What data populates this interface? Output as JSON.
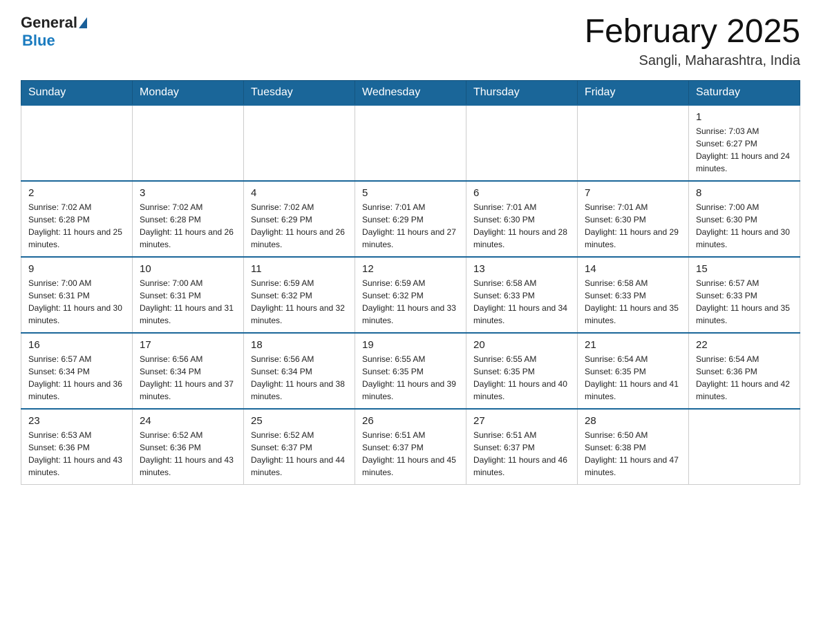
{
  "logo": {
    "general": "General",
    "blue": "Blue"
  },
  "title": "February 2025",
  "subtitle": "Sangli, Maharashtra, India",
  "days_of_week": [
    "Sunday",
    "Monday",
    "Tuesday",
    "Wednesday",
    "Thursday",
    "Friday",
    "Saturday"
  ],
  "weeks": [
    [
      {
        "day": "",
        "info": ""
      },
      {
        "day": "",
        "info": ""
      },
      {
        "day": "",
        "info": ""
      },
      {
        "day": "",
        "info": ""
      },
      {
        "day": "",
        "info": ""
      },
      {
        "day": "",
        "info": ""
      },
      {
        "day": "1",
        "info": "Sunrise: 7:03 AM\nSunset: 6:27 PM\nDaylight: 11 hours and 24 minutes."
      }
    ],
    [
      {
        "day": "2",
        "info": "Sunrise: 7:02 AM\nSunset: 6:28 PM\nDaylight: 11 hours and 25 minutes."
      },
      {
        "day": "3",
        "info": "Sunrise: 7:02 AM\nSunset: 6:28 PM\nDaylight: 11 hours and 26 minutes."
      },
      {
        "day": "4",
        "info": "Sunrise: 7:02 AM\nSunset: 6:29 PM\nDaylight: 11 hours and 26 minutes."
      },
      {
        "day": "5",
        "info": "Sunrise: 7:01 AM\nSunset: 6:29 PM\nDaylight: 11 hours and 27 minutes."
      },
      {
        "day": "6",
        "info": "Sunrise: 7:01 AM\nSunset: 6:30 PM\nDaylight: 11 hours and 28 minutes."
      },
      {
        "day": "7",
        "info": "Sunrise: 7:01 AM\nSunset: 6:30 PM\nDaylight: 11 hours and 29 minutes."
      },
      {
        "day": "8",
        "info": "Sunrise: 7:00 AM\nSunset: 6:30 PM\nDaylight: 11 hours and 30 minutes."
      }
    ],
    [
      {
        "day": "9",
        "info": "Sunrise: 7:00 AM\nSunset: 6:31 PM\nDaylight: 11 hours and 30 minutes."
      },
      {
        "day": "10",
        "info": "Sunrise: 7:00 AM\nSunset: 6:31 PM\nDaylight: 11 hours and 31 minutes."
      },
      {
        "day": "11",
        "info": "Sunrise: 6:59 AM\nSunset: 6:32 PM\nDaylight: 11 hours and 32 minutes."
      },
      {
        "day": "12",
        "info": "Sunrise: 6:59 AM\nSunset: 6:32 PM\nDaylight: 11 hours and 33 minutes."
      },
      {
        "day": "13",
        "info": "Sunrise: 6:58 AM\nSunset: 6:33 PM\nDaylight: 11 hours and 34 minutes."
      },
      {
        "day": "14",
        "info": "Sunrise: 6:58 AM\nSunset: 6:33 PM\nDaylight: 11 hours and 35 minutes."
      },
      {
        "day": "15",
        "info": "Sunrise: 6:57 AM\nSunset: 6:33 PM\nDaylight: 11 hours and 35 minutes."
      }
    ],
    [
      {
        "day": "16",
        "info": "Sunrise: 6:57 AM\nSunset: 6:34 PM\nDaylight: 11 hours and 36 minutes."
      },
      {
        "day": "17",
        "info": "Sunrise: 6:56 AM\nSunset: 6:34 PM\nDaylight: 11 hours and 37 minutes."
      },
      {
        "day": "18",
        "info": "Sunrise: 6:56 AM\nSunset: 6:34 PM\nDaylight: 11 hours and 38 minutes."
      },
      {
        "day": "19",
        "info": "Sunrise: 6:55 AM\nSunset: 6:35 PM\nDaylight: 11 hours and 39 minutes."
      },
      {
        "day": "20",
        "info": "Sunrise: 6:55 AM\nSunset: 6:35 PM\nDaylight: 11 hours and 40 minutes."
      },
      {
        "day": "21",
        "info": "Sunrise: 6:54 AM\nSunset: 6:35 PM\nDaylight: 11 hours and 41 minutes."
      },
      {
        "day": "22",
        "info": "Sunrise: 6:54 AM\nSunset: 6:36 PM\nDaylight: 11 hours and 42 minutes."
      }
    ],
    [
      {
        "day": "23",
        "info": "Sunrise: 6:53 AM\nSunset: 6:36 PM\nDaylight: 11 hours and 43 minutes."
      },
      {
        "day": "24",
        "info": "Sunrise: 6:52 AM\nSunset: 6:36 PM\nDaylight: 11 hours and 43 minutes."
      },
      {
        "day": "25",
        "info": "Sunrise: 6:52 AM\nSunset: 6:37 PM\nDaylight: 11 hours and 44 minutes."
      },
      {
        "day": "26",
        "info": "Sunrise: 6:51 AM\nSunset: 6:37 PM\nDaylight: 11 hours and 45 minutes."
      },
      {
        "day": "27",
        "info": "Sunrise: 6:51 AM\nSunset: 6:37 PM\nDaylight: 11 hours and 46 minutes."
      },
      {
        "day": "28",
        "info": "Sunrise: 6:50 AM\nSunset: 6:38 PM\nDaylight: 11 hours and 47 minutes."
      },
      {
        "day": "",
        "info": ""
      }
    ]
  ],
  "colors": {
    "header_bg": "#1a6699",
    "header_text": "#ffffff",
    "border": "#aaaaaa",
    "accent": "#1a7bbf"
  }
}
